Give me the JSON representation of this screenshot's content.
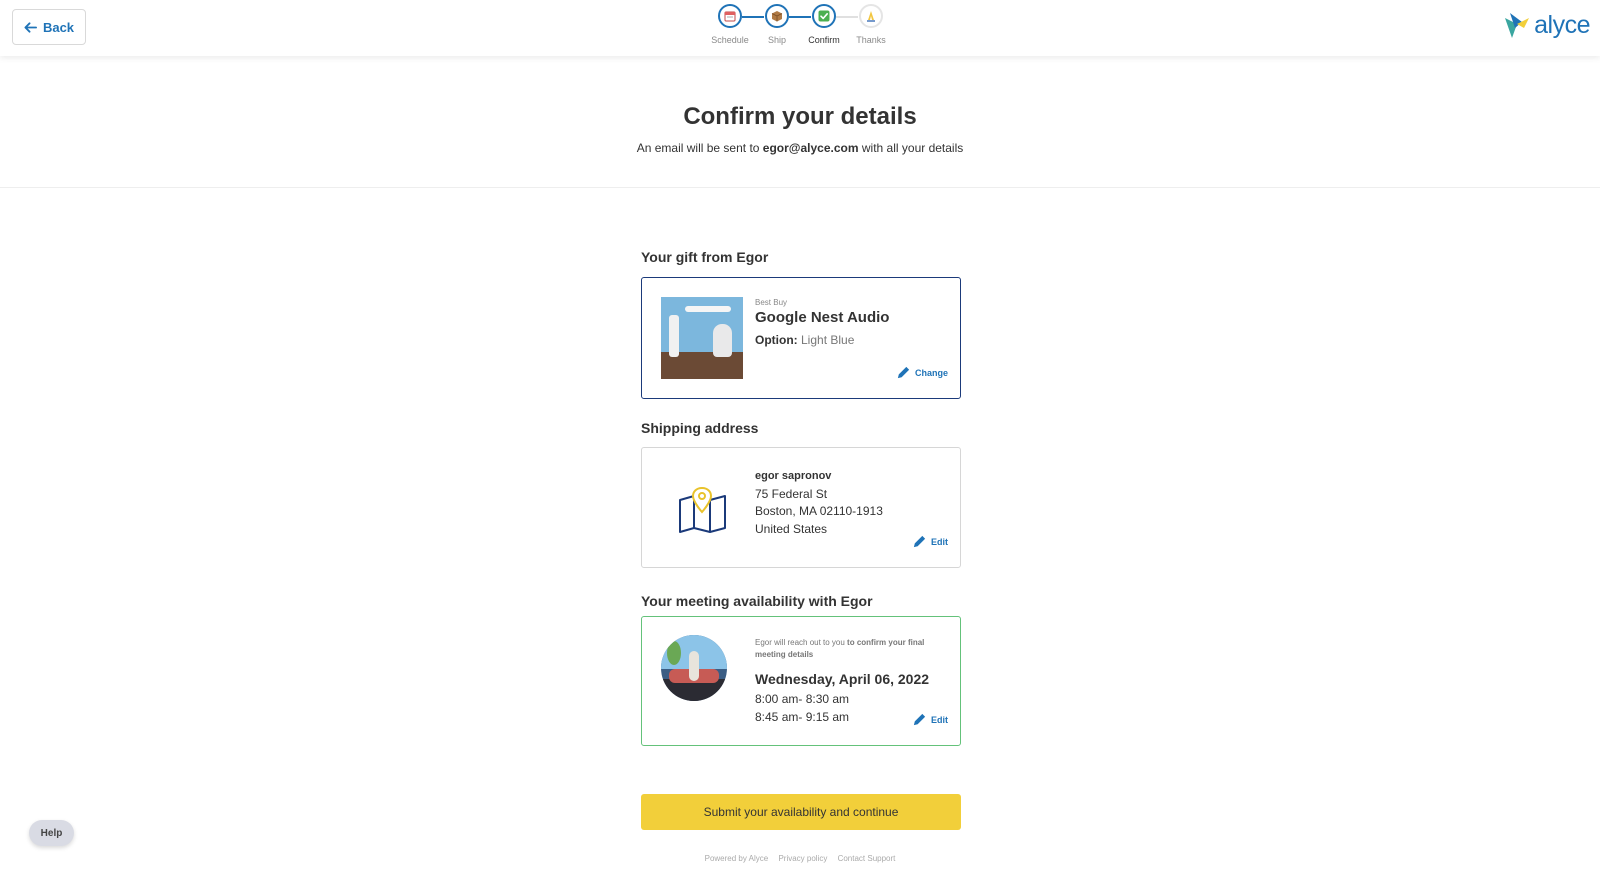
{
  "header": {
    "back_label": "Back",
    "steps": [
      {
        "label": "Schedule",
        "icon": "calendar-icon",
        "state": "done"
      },
      {
        "label": "Ship",
        "icon": "box-icon",
        "state": "done"
      },
      {
        "label": "Confirm",
        "icon": "check-icon",
        "state": "active"
      },
      {
        "label": "Thanks",
        "icon": "hands-icon",
        "state": "pending"
      }
    ],
    "logo_text": "alyce",
    "accent_color": "#1f73b7"
  },
  "hero": {
    "title": "Confirm your details",
    "sub_prefix": "An email will be sent to ",
    "email": "egor@alyce.com",
    "sub_suffix": " with all your details"
  },
  "gift": {
    "section_title": "Your gift from Egor",
    "vendor": "Best Buy",
    "name": "Google Nest Audio",
    "option_label": "Option:",
    "option_value": "Light Blue",
    "change_label": "Change"
  },
  "shipping": {
    "section_title": "Shipping address",
    "name": "egor sapronov",
    "line1": "75 Federal St",
    "line2": "Boston, MA 02110-1913",
    "country": "United States",
    "edit_label": "Edit"
  },
  "meeting": {
    "section_title": "Your meeting availability with Egor",
    "note_prefix": "Egor will reach out to you ",
    "note_bold": "to confirm your final meeting details",
    "date": "Wednesday, April 06, 2022",
    "slots": [
      "8:00 am- 8:30 am",
      "8:45 am- 9:15 am"
    ],
    "edit_label": "Edit"
  },
  "submit_label": "Submit your availability and continue",
  "footer": {
    "powered": "Powered by Alyce",
    "privacy": "Privacy policy",
    "support": "Contact Support"
  },
  "help_label": "Help"
}
